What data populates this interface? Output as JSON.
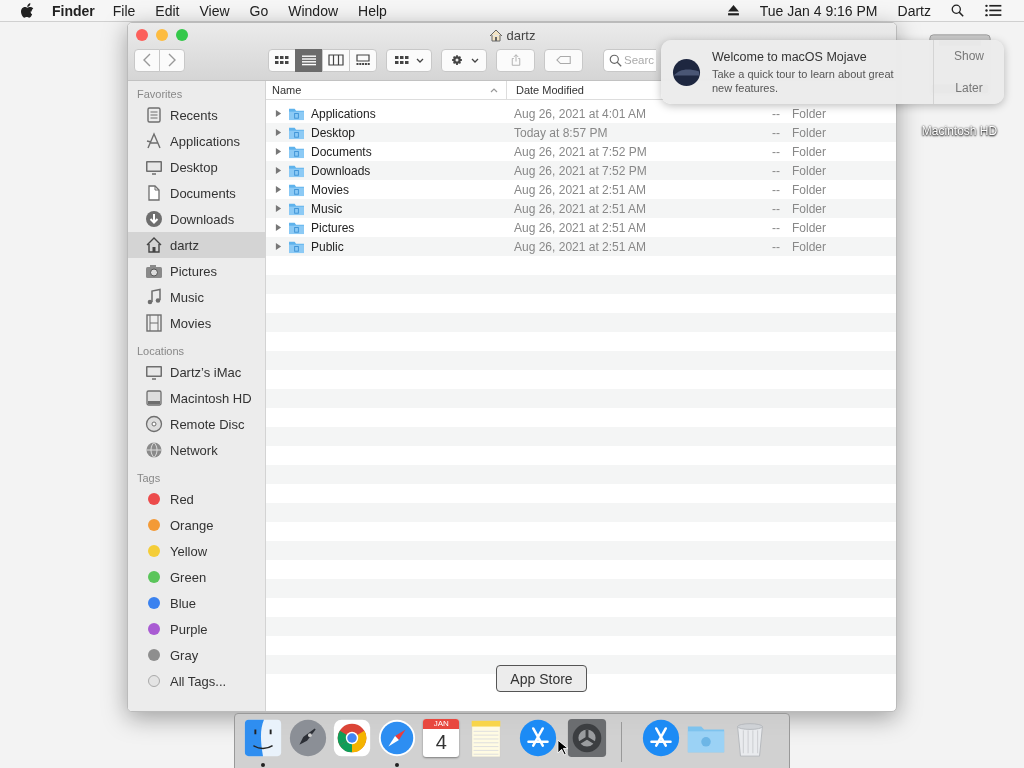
{
  "menu_bar": {
    "app_name": "Finder",
    "menus": [
      "File",
      "Edit",
      "View",
      "Go",
      "Window",
      "Help"
    ],
    "clock": "Tue Jan 4  9:16 PM",
    "user": "Dartz"
  },
  "window": {
    "title": "dartz",
    "toolbar": {
      "views": [
        {
          "kind": "icons",
          "selected": false
        },
        {
          "kind": "list",
          "selected": true
        },
        {
          "kind": "columns",
          "selected": false
        },
        {
          "kind": "gallery",
          "selected": false
        }
      ],
      "search": {
        "placeholder": "Searc"
      }
    },
    "sidebar": {
      "sections": [
        {
          "title": "Favorites",
          "items": [
            {
              "label": "Recents",
              "kind": "recents",
              "selected": false
            },
            {
              "label": "Applications",
              "kind": "applications",
              "selected": false
            },
            {
              "label": "Desktop",
              "kind": "desktop",
              "selected": false
            },
            {
              "label": "Documents",
              "kind": "documents",
              "selected": false
            },
            {
              "label": "Downloads",
              "kind": "downloads",
              "selected": false
            },
            {
              "label": "dartz",
              "kind": "home",
              "selected": true
            },
            {
              "label": "Pictures",
              "kind": "pictures",
              "selected": false
            },
            {
              "label": "Music",
              "kind": "music",
              "selected": false
            },
            {
              "label": "Movies",
              "kind": "movies",
              "selected": false
            }
          ]
        },
        {
          "title": "Locations",
          "items": [
            {
              "label": "Dartz’s iMac",
              "kind": "imac",
              "selected": false
            },
            {
              "label": "Macintosh HD",
              "kind": "disk",
              "selected": false
            },
            {
              "label": "Remote Disc",
              "kind": "disc",
              "selected": false
            },
            {
              "label": "Network",
              "kind": "network",
              "selected": false
            }
          ]
        },
        {
          "title": "Tags",
          "items": [
            {
              "label": "Red",
              "kind": "tag",
              "color": "#ec4b4b",
              "selected": false
            },
            {
              "label": "Orange",
              "kind": "tag",
              "color": "#f39a37",
              "selected": false
            },
            {
              "label": "Yellow",
              "kind": "tag",
              "color": "#f4cd38",
              "selected": false
            },
            {
              "label": "Green",
              "kind": "tag",
              "color": "#5ac55a",
              "selected": false
            },
            {
              "label": "Blue",
              "kind": "tag",
              "color": "#3b82ef",
              "selected": false
            },
            {
              "label": "Purple",
              "kind": "tag",
              "color": "#a95bd3",
              "selected": false
            },
            {
              "label": "Gray",
              "kind": "tag",
              "color": "#8e8e8e",
              "selected": false
            },
            {
              "label": "All Tags...",
              "kind": "alltags",
              "selected": false
            }
          ]
        }
      ]
    },
    "table": {
      "columns": [
        "Name",
        "Date Modified"
      ],
      "rows": [
        {
          "name": "Applications",
          "date_modified": "Aug 26, 2021 at 4:01 AM",
          "size": "--",
          "kind": "Folder",
          "expanded": false
        },
        {
          "name": "Desktop",
          "date_modified": "Today at 8:57 PM",
          "size": "--",
          "kind": "Folder",
          "expanded": false
        },
        {
          "name": "Documents",
          "date_modified": "Aug 26, 2021 at 7:52 PM",
          "size": "--",
          "kind": "Folder",
          "expanded": false
        },
        {
          "name": "Downloads",
          "date_modified": "Aug 26, 2021 at 7:52 PM",
          "size": "--",
          "kind": "Folder",
          "expanded": false
        },
        {
          "name": "Movies",
          "date_modified": "Aug 26, 2021 at 2:51 AM",
          "size": "--",
          "kind": "Folder",
          "expanded": false
        },
        {
          "name": "Music",
          "date_modified": "Aug 26, 2021 at 2:51 AM",
          "size": "--",
          "kind": "Folder",
          "expanded": false
        },
        {
          "name": "Pictures",
          "date_modified": "Aug 26, 2021 at 2:51 AM",
          "size": "--",
          "kind": "Folder",
          "expanded": false
        },
        {
          "name": "Public",
          "date_modified": "Aug 26, 2021 at 2:51 AM",
          "size": "--",
          "kind": "Folder",
          "expanded": false
        }
      ]
    }
  },
  "notification": {
    "title": "Welcome to macOS Mojave",
    "body": "Take a quick tour to learn about great new features.",
    "actions": [
      "Show",
      "Later"
    ]
  },
  "desktop_icons": [
    {
      "label": "Macintosh HD"
    }
  ],
  "dock": {
    "tooltip": "App Store",
    "items": [
      {
        "kind": "finder",
        "running": true
      },
      {
        "kind": "launchpad",
        "running": false
      },
      {
        "kind": "chrome",
        "running": false
      },
      {
        "kind": "safari",
        "running": true
      },
      {
        "kind": "calendar",
        "running": false,
        "month": "JAN",
        "day": "4"
      },
      {
        "kind": "notes",
        "running": false
      },
      {
        "kind": "appstore",
        "running": false
      },
      {
        "kind": "settings",
        "running": false
      },
      {
        "kind": "separator"
      },
      {
        "kind": "appstore-downloads",
        "running": false
      },
      {
        "kind": "downloads-folder",
        "running": false
      },
      {
        "kind": "trash",
        "running": false
      }
    ]
  }
}
